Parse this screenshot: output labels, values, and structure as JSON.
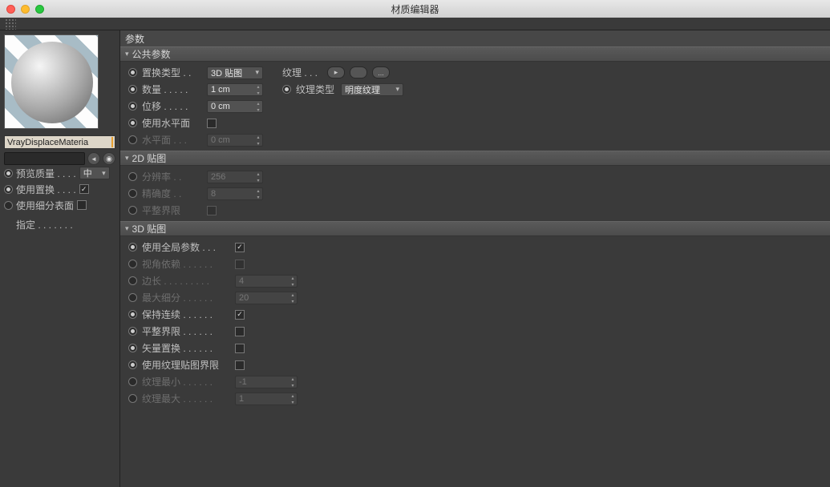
{
  "window": {
    "title": "材质编辑器"
  },
  "sidebar": {
    "material_name": "VrayDisplaceMateria",
    "preview_quality": {
      "label": "预览质量 . . . .",
      "value": "中"
    },
    "use_displace": {
      "label": "使用置换 . . . .",
      "checked": true
    },
    "use_subdiv": {
      "label": "使用细分表面",
      "checked": false
    },
    "assign": "指定 . . . . . . ."
  },
  "panel_title": "参数",
  "groups": {
    "common": {
      "title": "公共参数",
      "displace_type": {
        "label": "置换类型 . .",
        "value": "3D 贴图"
      },
      "amount": {
        "label": "数量 . . . . .",
        "value": "1 cm"
      },
      "shift": {
        "label": "位移 . . . . .",
        "value": "0 cm"
      },
      "use_water": {
        "label": "使用水平面",
        "checked": false
      },
      "water_level": {
        "label": "水平面 . . .",
        "value": "0 cm"
      },
      "texture": {
        "label": "纹理 . . ."
      },
      "tex_type": {
        "label": "纹理类型",
        "value": "明度纹理"
      }
    },
    "map2d": {
      "title": "2D 贴图",
      "resolution": {
        "label": "分辨率 . .",
        "value": "256"
      },
      "precision": {
        "label": "精确度 . .",
        "value": "8"
      },
      "tight_bounds": {
        "label": "平整界限",
        "checked": false
      }
    },
    "map3d": {
      "title": "3D 贴图",
      "use_global": {
        "label": "使用全局参数 . . .",
        "checked": true
      },
      "view_dep": {
        "label": "视角依赖 . . . . . .",
        "checked": false
      },
      "edge_len": {
        "label": "边长 . . . . . . . . .",
        "value": "4"
      },
      "max_subdiv": {
        "label": "最大细分 . . . . . .",
        "value": "20"
      },
      "keep_cont": {
        "label": "保持连续 . . . . . .",
        "checked": true
      },
      "tight_bounds": {
        "label": "平整界限 . . . . . .",
        "checked": false
      },
      "vector_disp": {
        "label": "矢量置换 . . . . . .",
        "checked": false
      },
      "use_tex_bounds": {
        "label": "使用纹理贴图界限",
        "checked": false
      },
      "tex_min": {
        "label": "纹理最小 . . . . . .",
        "value": "-1"
      },
      "tex_max": {
        "label": "纹理最大 . . . . . .",
        "value": "1"
      }
    }
  }
}
